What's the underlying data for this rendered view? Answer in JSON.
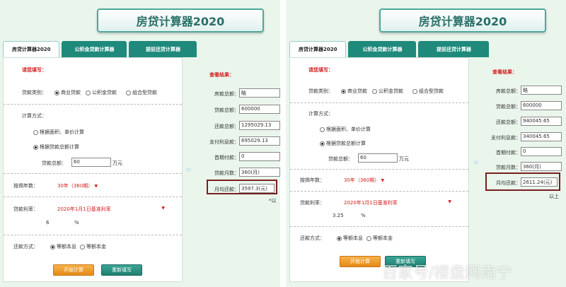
{
  "title": "房贷计算器2020",
  "tabs": [
    "房贷计算器2020",
    "公积金贷款计算器",
    "提前还贷计算器"
  ],
  "form": {
    "heading": "请您填写：",
    "loan_type_label": "贷款类别：",
    "loan_types": [
      "商业贷款",
      "公积金贷款",
      "组合型贷款"
    ],
    "calc_method_label": "计算方式：",
    "calc_methods": [
      "根据面积、单价计算",
      "根据贷款总额计算"
    ],
    "loan_amount_label": "贷款总额：",
    "loan_amount": "60",
    "loan_amount_unit": "万元",
    "years_label": "按揭年数：",
    "years_value": "30年（360期）",
    "rate_label": "贷款利率：",
    "rate_value": "2020年1月1日基准利率",
    "rate_unit": "%",
    "repay_label": "还款方式：",
    "repay_options": [
      "等额本息",
      "等额本金"
    ],
    "start_button": "开始计算",
    "reset_button": "重新填写"
  },
  "results_heading": "查看结果：",
  "result_labels": [
    "房款总额：",
    "贷款总额：",
    "还款总额：",
    "支付利息款：",
    "首期付款：",
    "贷款月数：",
    "月均还款："
  ],
  "left": {
    "rate_input": "6",
    "results": [
      "略",
      "600000",
      "1295029.13",
      "695029.13",
      "0",
      "360(月)",
      "3597.3(元)"
    ],
    "note": "*以"
  },
  "right": {
    "rate_input": "3.25",
    "results": [
      "略",
      "600000",
      "940045.65",
      "340045.65",
      "0",
      "360(月)",
      "2611.24(元)"
    ],
    "note": "以上"
  },
  "watermark": "百家号/楼盘网南宁",
  "colors": {
    "tab_bg": "#1f8a7c",
    "accent_red": "#d21f1f",
    "highlight": "#7a1f1f"
  }
}
